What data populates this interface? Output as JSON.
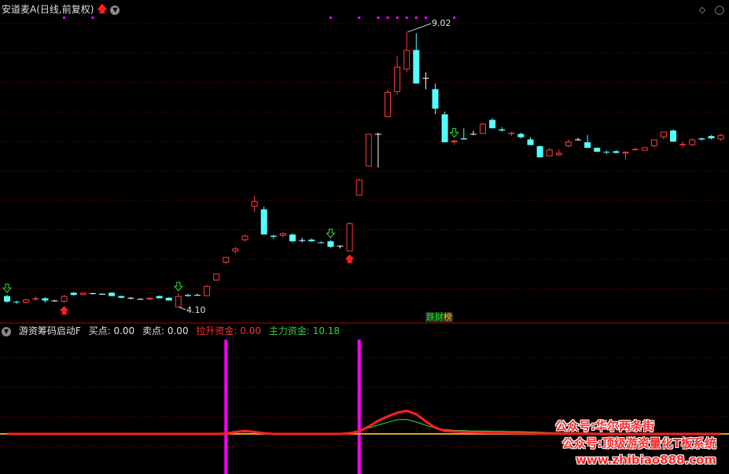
{
  "header": {
    "title": "安道麦A(日线,前复权)",
    "up_arrow_icon": "red-up-arrow-icon",
    "dropdown_icon": "chevron-down-circle-icon"
  },
  "window_controls": {
    "diamond_icon": "◇",
    "circle_icon": "◯"
  },
  "price_labels": {
    "high": "9.02",
    "low": "4.10"
  },
  "badge": {
    "part1": "跌财",
    "part2": "榜"
  },
  "indicator": {
    "name": "游资筹码启动F",
    "buy_label": "买点:",
    "buy_value": "0.00",
    "sell_label": "卖点:",
    "sell_value": "0.00",
    "pull_label": "拉升资金:",
    "pull_value": "0.00",
    "main_label": "主力资金:",
    "main_value": "10.18"
  },
  "watermark": {
    "line1": "公众号:华尔两条街",
    "line2": "公众号:顶级游资量化T板系统",
    "line3": "www.zhibiao888.com"
  },
  "colors": {
    "up": "#ff3b3b",
    "down": "#54ffff",
    "flat": "#ffffff",
    "grid": "#8b0000",
    "magenta": "#ff00ff",
    "line_red": "#ff2020",
    "line_green": "#40e040",
    "line_orange": "#e0a020"
  },
  "chart_data": {
    "type": "candlestick",
    "ohlc": [
      [
        4.3,
        4.32,
        4.18,
        4.2
      ],
      [
        4.2,
        4.22,
        4.16,
        4.19
      ],
      [
        4.18,
        4.25,
        4.17,
        4.24
      ],
      [
        4.24,
        4.3,
        4.22,
        4.26
      ],
      [
        4.26,
        4.28,
        4.18,
        4.22
      ],
      [
        4.22,
        4.23,
        4.2,
        4.22
      ],
      [
        4.2,
        4.32,
        4.18,
        4.3
      ],
      [
        4.36,
        4.37,
        4.31,
        4.32
      ],
      [
        4.32,
        4.37,
        4.31,
        4.36
      ],
      [
        4.35,
        4.36,
        4.33,
        4.35
      ],
      [
        4.34,
        4.35,
        4.33,
        4.34
      ],
      [
        4.36,
        4.37,
        4.3,
        4.3
      ],
      [
        4.3,
        4.31,
        4.26,
        4.27
      ],
      [
        4.27,
        4.28,
        4.24,
        4.27
      ],
      [
        4.25,
        4.26,
        4.24,
        4.25
      ],
      [
        4.24,
        4.27,
        4.23,
        4.27
      ],
      [
        4.3,
        4.31,
        4.26,
        4.26
      ],
      [
        4.27,
        4.28,
        4.22,
        4.22
      ],
      [
        4.1,
        4.35,
        4.1,
        4.3
      ],
      [
        4.32,
        4.34,
        4.29,
        4.3
      ],
      [
        4.32,
        4.34,
        4.31,
        4.32
      ],
      [
        4.3,
        4.5,
        4.3,
        4.48
      ],
      [
        4.58,
        4.7,
        4.58,
        4.7
      ],
      [
        4.9,
        5.0,
        4.88,
        5.0
      ],
      [
        5.1,
        5.18,
        5.06,
        5.15
      ],
      [
        5.3,
        5.4,
        5.28,
        5.38
      ],
      [
        5.9,
        6.1,
        5.8,
        6.0
      ],
      [
        5.85,
        5.9,
        5.4,
        5.4
      ],
      [
        5.38,
        5.4,
        5.32,
        5.36
      ],
      [
        5.38,
        5.44,
        5.35,
        5.42
      ],
      [
        5.4,
        5.42,
        5.26,
        5.28
      ],
      [
        5.3,
        5.34,
        5.26,
        5.3
      ],
      [
        5.31,
        5.33,
        5.27,
        5.28
      ],
      [
        5.26,
        5.28,
        5.24,
        5.25
      ],
      [
        5.28,
        5.3,
        5.16,
        5.18
      ],
      [
        5.2,
        5.21,
        5.15,
        5.2
      ],
      [
        5.1,
        5.62,
        5.1,
        5.6
      ],
      [
        6.1,
        6.4,
        6.1,
        6.38
      ],
      [
        6.62,
        7.2,
        6.62,
        7.2
      ],
      [
        7.2,
        7.22,
        6.6,
        7.2
      ],
      [
        7.5,
        8.0,
        7.5,
        7.95
      ],
      [
        7.95,
        8.6,
        7.9,
        8.4
      ],
      [
        8.35,
        9.02,
        8.3,
        8.7
      ],
      [
        8.7,
        9.0,
        8.1,
        8.1
      ],
      [
        8.2,
        8.3,
        8.0,
        8.2
      ],
      [
        8.0,
        8.1,
        7.55,
        7.65
      ],
      [
        7.55,
        7.6,
        7.05,
        7.05
      ],
      [
        7.05,
        7.1,
        7.0,
        7.08
      ],
      [
        7.12,
        7.3,
        7.1,
        7.1
      ],
      [
        7.2,
        7.25,
        7.18,
        7.2
      ],
      [
        7.2,
        7.4,
        7.2,
        7.38
      ],
      [
        7.45,
        7.48,
        7.3,
        7.3
      ],
      [
        7.28,
        7.32,
        7.24,
        7.26
      ],
      [
        7.2,
        7.24,
        7.16,
        7.22
      ],
      [
        7.2,
        7.22,
        7.12,
        7.14
      ],
      [
        7.1,
        7.14,
        7.0,
        7.0
      ],
      [
        6.98,
        6.99,
        6.78,
        6.78
      ],
      [
        6.8,
        6.95,
        6.8,
        6.92
      ],
      [
        6.82,
        6.92,
        6.8,
        6.86
      ],
      [
        6.98,
        7.1,
        6.96,
        7.06
      ],
      [
        7.1,
        7.13,
        7.08,
        7.1
      ],
      [
        7.05,
        7.18,
        6.95,
        6.95
      ],
      [
        6.95,
        6.96,
        6.88,
        6.88
      ],
      [
        6.88,
        6.9,
        6.84,
        6.87
      ],
      [
        6.89,
        6.91,
        6.85,
        6.86
      ],
      [
        6.85,
        6.89,
        6.74,
        6.88
      ],
      [
        6.92,
        6.95,
        6.9,
        6.93
      ],
      [
        6.9,
        6.96,
        6.9,
        6.96
      ],
      [
        6.98,
        7.1,
        6.96,
        7.1
      ],
      [
        7.14,
        7.24,
        7.1,
        7.24
      ],
      [
        7.26,
        7.28,
        7.06,
        7.06
      ],
      [
        7.0,
        7.06,
        6.96,
        7.02
      ],
      [
        7.0,
        7.12,
        6.98,
        7.1
      ],
      [
        7.12,
        7.13,
        7.08,
        7.1
      ],
      [
        7.16,
        7.18,
        7.1,
        7.12
      ],
      [
        7.1,
        7.2,
        7.08,
        7.18
      ]
    ],
    "buy_signals_idx": [
      6,
      36
    ],
    "sell_signals_idx": [
      0,
      18,
      34,
      47
    ],
    "top_marker_idx": [
      6,
      9,
      34,
      37,
      39,
      40,
      41,
      42,
      43,
      44,
      47
    ],
    "high_label": "9.02",
    "low_label": "4.10",
    "ylim": [
      4.0,
      9.2
    ],
    "indicator_magenta_idx": [
      23,
      37
    ],
    "indicator_lines": {
      "red": [
        0,
        0,
        0,
        0,
        0,
        0,
        0,
        0,
        0,
        0,
        0,
        0,
        0,
        0,
        0,
        0,
        0,
        0,
        0,
        0,
        0,
        0,
        0,
        0.1,
        0.6,
        0.9,
        0.6,
        0.2,
        0,
        0,
        0,
        0,
        0,
        0,
        0,
        0,
        0.2,
        0.8,
        2.2,
        4.0,
        5.3,
        6.4,
        7.0,
        6.0,
        3.8,
        1.9,
        0.9,
        0.7,
        0.6,
        0.5,
        0.4,
        0.3,
        0.3,
        0.2,
        0.2,
        0.2,
        0.1,
        0.1,
        0.1,
        0.1,
        0.1,
        0.1,
        0,
        0,
        0,
        0,
        0,
        0,
        0,
        0,
        0,
        0,
        0,
        0,
        0,
        0
      ],
      "green": [
        0,
        0,
        0,
        0,
        0,
        0,
        0,
        0,
        0,
        0,
        0,
        0,
        0,
        0,
        0,
        0,
        0,
        0,
        0,
        0,
        0,
        0,
        0,
        0.2,
        0.5,
        0.6,
        0.5,
        0.3,
        0.1,
        0.1,
        0,
        0,
        0,
        0,
        0,
        0.1,
        0.3,
        0.9,
        1.8,
        2.7,
        3.5,
        4.3,
        4.4,
        3.6,
        2.6,
        1.8,
        1.3,
        1.1,
        1.0,
        0.9,
        0.9,
        0.8,
        0.8,
        0.7,
        0.7,
        0.6,
        0.5,
        0.4,
        0.4,
        0.3,
        0.3,
        0.2,
        0.2,
        0.1,
        0.1,
        0.1,
        0.1,
        0.1,
        0.1,
        0.1,
        0.1,
        0.1,
        0.1,
        0.1,
        0.1,
        0.1
      ],
      "orange": [
        0,
        0,
        0,
        0,
        0,
        0,
        0,
        0,
        0,
        0,
        0,
        0,
        0,
        0,
        0,
        0,
        0,
        0,
        0,
        0,
        0,
        0,
        0,
        0,
        0,
        0,
        0,
        0,
        0,
        0,
        0,
        0,
        0,
        0,
        0,
        0,
        0,
        0,
        0,
        0,
        0,
        0,
        0,
        0,
        0,
        0,
        0,
        0,
        0,
        0,
        0,
        0,
        0,
        0,
        0,
        0,
        0,
        0,
        0,
        0,
        0,
        0,
        0,
        0,
        0,
        0,
        0,
        0,
        0,
        0,
        0,
        0,
        0,
        0,
        0,
        0
      ]
    }
  }
}
